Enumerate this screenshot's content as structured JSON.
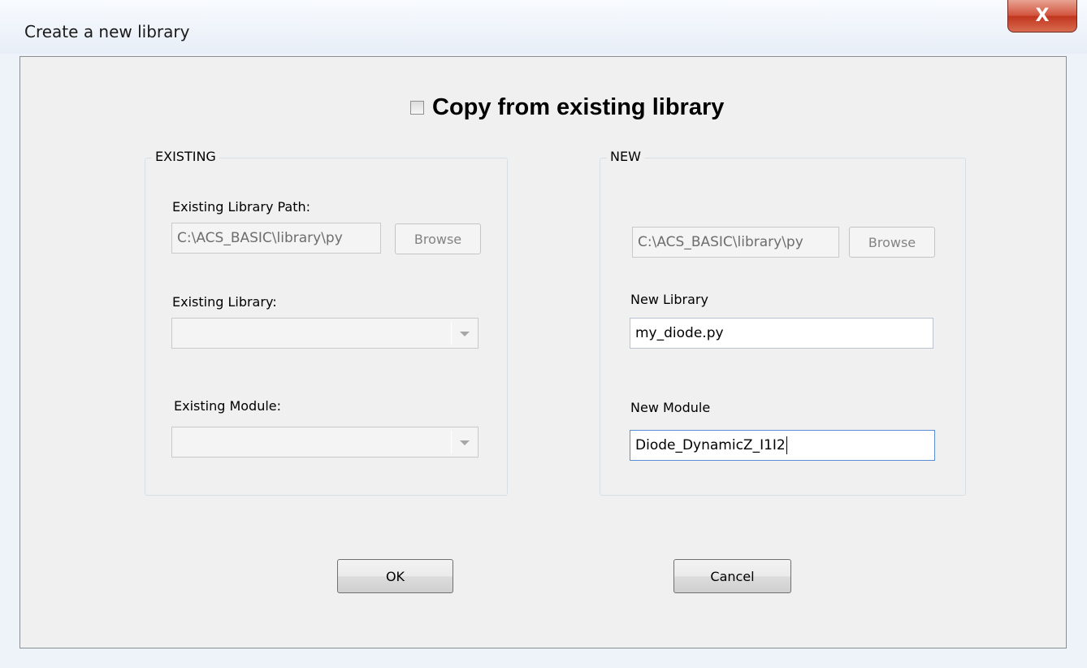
{
  "window": {
    "title": "Create a new library",
    "close_label": "X"
  },
  "copy_checkbox": {
    "label": "Copy from existing library",
    "checked": false
  },
  "existing": {
    "group_title": "EXISTING",
    "path_label": "Existing Library Path:",
    "path_value": "C:\\ACS_BASIC\\library\\py",
    "browse_label": "Browse",
    "library_label": "Existing Library:",
    "library_value": "",
    "module_label": "Existing Module:",
    "module_value": ""
  },
  "new": {
    "group_title": "NEW",
    "path_value": "C:\\ACS_BASIC\\library\\py",
    "browse_label": "Browse",
    "library_label": "New Library",
    "library_value": "my_diode.py",
    "module_label": "New Module",
    "module_value": "Diode_DynamicZ_I1I2"
  },
  "buttons": {
    "ok_label": "OK",
    "cancel_label": "Cancel"
  },
  "colors": {
    "close_button": "#c1361f",
    "dialog_bg": "#f0f0f0",
    "focus_border": "#5a8ed4"
  }
}
